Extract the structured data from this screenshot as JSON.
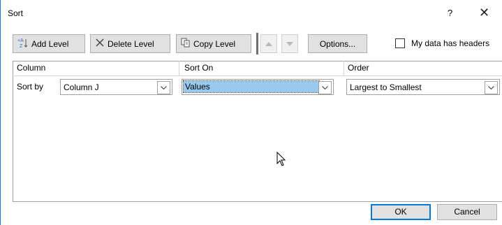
{
  "dialog": {
    "title": "Sort",
    "help": "?",
    "close": "✕"
  },
  "toolbar": {
    "add_level": "Add Level",
    "delete_level": "Delete Level",
    "copy_level": "Copy Level",
    "options": "Options...",
    "headers_checkbox": "My data has headers",
    "headers_checked": false
  },
  "grid": {
    "headers": {
      "column": "Column",
      "sort_on": "Sort On",
      "order": "Order"
    },
    "rows": [
      {
        "label": "Sort by",
        "column": "Column J",
        "sort_on": "Values",
        "order": "Largest to Smallest"
      }
    ]
  },
  "buttons": {
    "ok": "OK",
    "cancel": "Cancel"
  },
  "icons": {
    "add": "add-level-icon",
    "delete": "delete-x-icon",
    "copy": "copy-icon",
    "up": "move-up-icon",
    "down": "move-down-icon",
    "dropdown": "chevron-down-icon",
    "cursor": "mouse-pointer-icon"
  },
  "colors": {
    "accent": "#0078d7",
    "selection": "#99c9ef",
    "button_face": "#e1e1e1"
  }
}
